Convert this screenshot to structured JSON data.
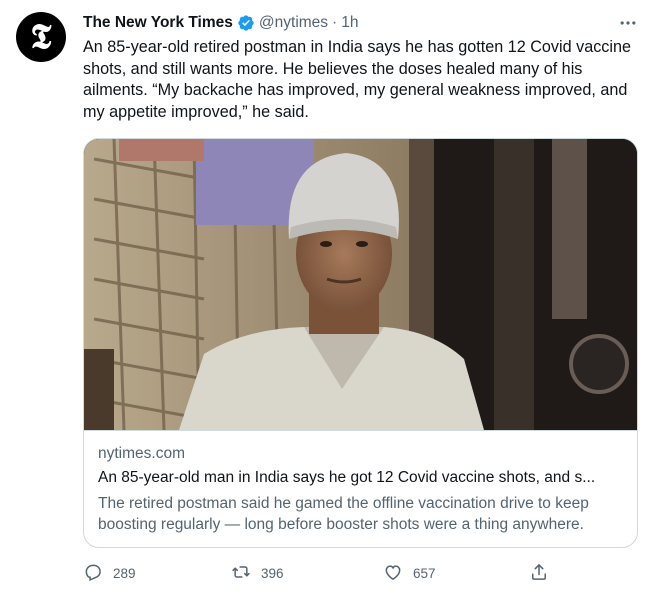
{
  "tweet": {
    "avatar_glyph": "𝕿",
    "author_name": "The New York Times",
    "handle": "@nytimes",
    "separator": "·",
    "time": "1h",
    "text": "An 85-year-old retired postman in India says he has gotten 12 Covid vaccine shots, and still wants more. He believes the doses healed many of his ailments. “My backache has improved, my general weakness improved, and my appetite improved,” he said."
  },
  "card": {
    "domain": "nytimes.com",
    "title": "An 85-year-old man in India says he got 12 Covid vaccine shots, and s...",
    "description": "The retired postman said he gamed the offline vaccination drive to keep boosting regularly — long before booster shots were a thing anywhere."
  },
  "actions": {
    "replies": "289",
    "retweets": "396",
    "likes": "657"
  },
  "colors": {
    "verified": "#1d9bf0",
    "secondary_text": "#536471",
    "border": "#cfd9de"
  }
}
